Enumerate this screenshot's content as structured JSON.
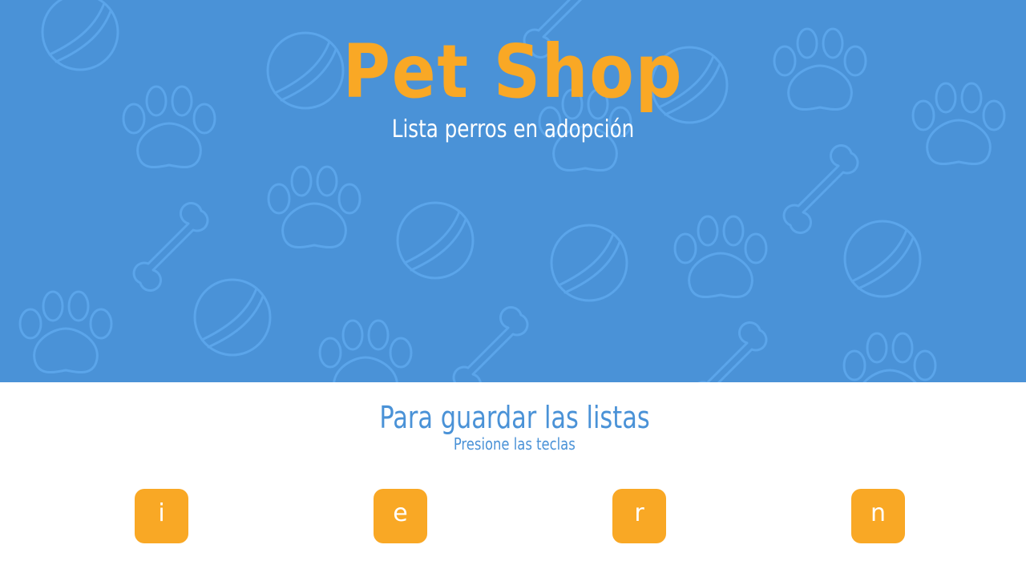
{
  "hero": {
    "title": "Pet Shop",
    "subtitle": "Lista perros en adopción",
    "background_color": "#4a92d7",
    "pattern_icons": [
      "ball-icon",
      "paw-icon",
      "bone-icon"
    ]
  },
  "save_section": {
    "title": "Para guardar las listas",
    "subtitle": "Presione las teclas",
    "keys": [
      {
        "label": "i"
      },
      {
        "label": "e"
      },
      {
        "label": "r"
      },
      {
        "label": "n"
      }
    ]
  },
  "colors": {
    "accent": "#f9a825",
    "primary": "#4a92d7",
    "pattern": "#5ba5ea"
  }
}
